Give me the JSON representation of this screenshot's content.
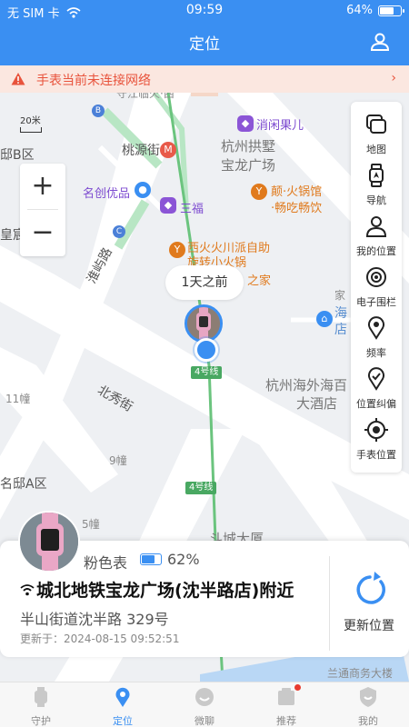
{
  "status_bar": {
    "carrier": "无 SIM 卡",
    "time": "09:59",
    "battery_percent": "64%",
    "battery_level": 0.64
  },
  "header": {
    "title": "定位",
    "user_icon": "user-location-icon"
  },
  "alert": {
    "text": "手表当前未连接网络",
    "arrow": "›"
  },
  "map": {
    "scale": "20米",
    "labels": {
      "taoyuan": "桃源街",
      "gongshu_1": "杭州拱墅",
      "gongshu_2": "宝龙广场",
      "xiaojie": "消闲果儿",
      "mingchuang": "名创优品",
      "sanfu": "三福",
      "dian_1": "颠·火锅馆",
      "dian_2": "·畅吃畅饮",
      "xihuo_1": "西火火川派自助",
      "xihuo_2": "旋转小火锅",
      "zhijia": "之家",
      "jia": "家",
      "di": "邸B区",
      "huang": "皇宸",
      "haiwai_1": "杭州海外海百",
      "haiwai_2": "大酒店",
      "beixiu": "北秀街",
      "huaiyu": "淮屿路",
      "bldg_11": "11幢",
      "bldg_9": "9幢",
      "bldg_5": "5幢",
      "mingdi_a": "名邸A区",
      "dou": "斗城大厦",
      "hai_1": "海",
      "hai_2": "店",
      "partial_top": "守江临火·西",
      "lantong": "兰通商务大楼"
    },
    "metro_tag_1": "4号线",
    "metro_tag_2": "4号线",
    "poi_b": "B",
    "poi_c": "C",
    "bubble": "1天之前"
  },
  "zoom": {
    "in": "+",
    "out": "−"
  },
  "tools": [
    {
      "label": "地图",
      "icon": "map-layers-icon"
    },
    {
      "label": "导航",
      "icon": "watch-navigation-icon"
    },
    {
      "label": "我的位置",
      "icon": "person-icon"
    },
    {
      "label": "电子围栏",
      "icon": "geofence-icon"
    },
    {
      "label": "频率",
      "icon": "frequency-pin-icon"
    },
    {
      "label": "位置纠偏",
      "icon": "location-correct-icon"
    },
    {
      "label": "手表位置",
      "icon": "crosshair-icon"
    }
  ],
  "device": {
    "name": "粉色表",
    "battery": "62%",
    "battery_level": 0.62,
    "address": "城北地铁宝龙广场(沈半路店)附近",
    "street": "半山街道沈半路 329号",
    "updated": "更新于：2024-08-15 09:52:51",
    "refresh_label": "更新位置"
  },
  "tabs": [
    {
      "label": "守护",
      "icon": "watch-icon",
      "active": false
    },
    {
      "label": "定位",
      "icon": "location-pin-icon",
      "active": true
    },
    {
      "label": "微聊",
      "icon": "chat-icon",
      "active": false
    },
    {
      "label": "推荐",
      "icon": "recommend-icon",
      "active": false,
      "badge": true
    },
    {
      "label": "我的",
      "icon": "profile-shield-icon",
      "active": false
    }
  ],
  "colors": {
    "accent": "#3a8ff2",
    "alert_bg": "#fbe7e0",
    "alert_text": "#e8533c"
  }
}
